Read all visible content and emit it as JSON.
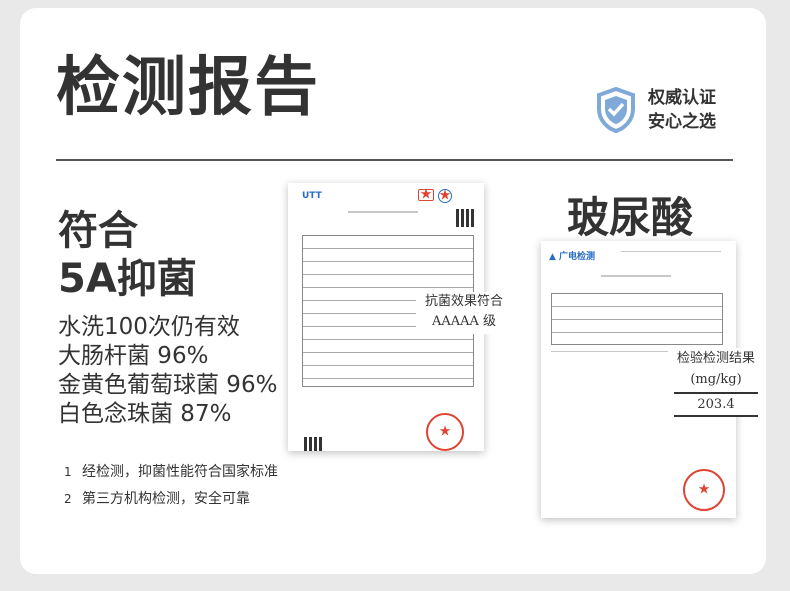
{
  "title": "检测报告",
  "badge": {
    "line1": "权威认证",
    "line2": "安心之选",
    "icon": "shield-check-icon",
    "color": "#7fa9d9"
  },
  "claim": {
    "line1": "符合",
    "line2": "5A抑菌"
  },
  "stats": [
    "水洗100次仍有效",
    "大肠杆菌 96%",
    "金黄色葡萄球菌 96%",
    "白色念珠菌 87%"
  ],
  "notes": [
    {
      "num": "1",
      "text": "经检测，抑菌性能符合国家标准"
    },
    {
      "num": "2",
      "text": "第三方机构检测，安全可靠"
    }
  ],
  "report1": {
    "callout_line1": "抗菌效果符合",
    "callout_line2": "AAAAA 级"
  },
  "report2": {
    "product": "玻尿酸",
    "callout_title": "检验检测结果",
    "callout_unit": "(mg/kg)",
    "callout_value": "203.4"
  }
}
